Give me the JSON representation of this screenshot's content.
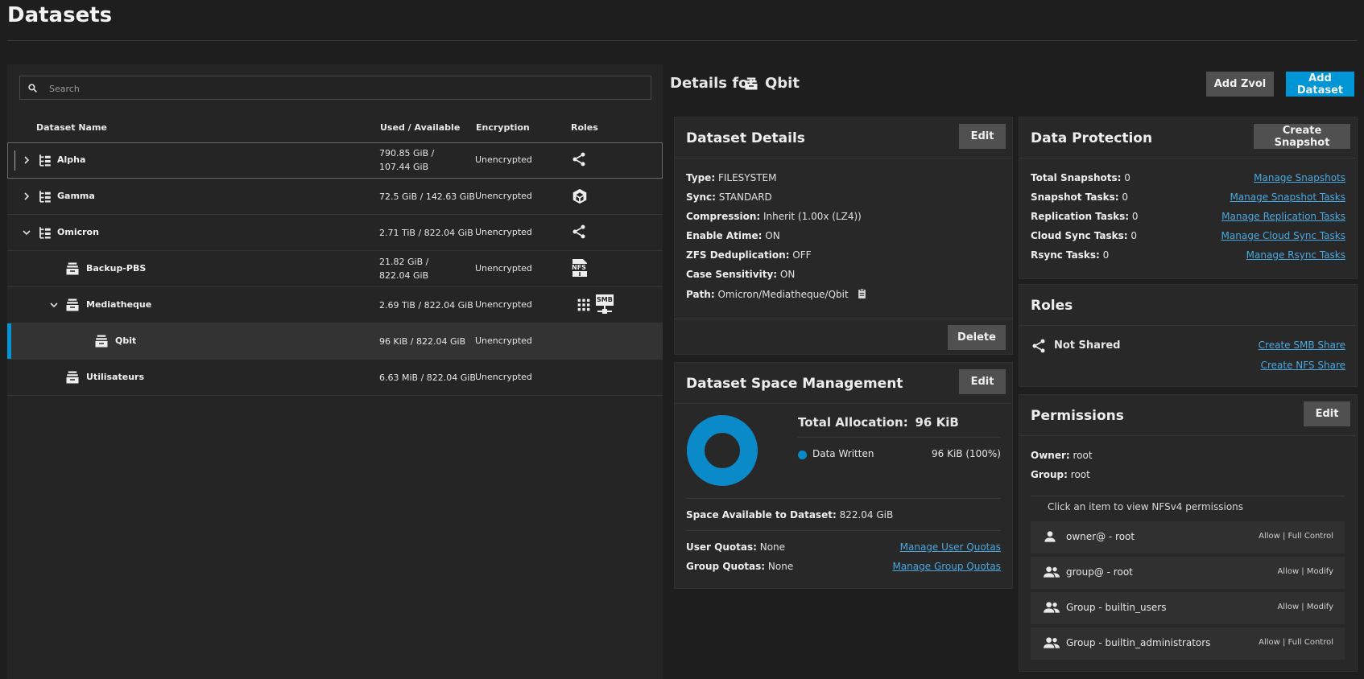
{
  "page_title": "Datasets",
  "search": {
    "placeholder": "Search"
  },
  "table": {
    "headers": {
      "name": "Dataset Name",
      "used": "Used / Available",
      "encryption": "Encryption",
      "roles": "Roles"
    },
    "rows": [
      {
        "name": "Alpha",
        "used_line1": "790.85 GiB /",
        "used_line2": "107.44 GiB",
        "encryption": "Unencrypted",
        "icon": "pool-tree-icon",
        "caret": "chevron-right-icon",
        "roles": [
          "share-icon"
        ]
      },
      {
        "name": "Gamma",
        "used_line1": "72.5 GiB / 142.63 GiB",
        "used_line2": "",
        "encryption": "Unencrypted",
        "icon": "pool-tree-icon",
        "caret": "chevron-right-icon",
        "roles": [
          "apps-cube-icon"
        ]
      },
      {
        "name": "Omicron",
        "used_line1": "2.71 TiB / 822.04 GiB",
        "used_line2": "",
        "encryption": "Unencrypted",
        "icon": "pool-tree-icon",
        "caret": "chevron-down-icon",
        "roles": [
          "share-icon"
        ]
      },
      {
        "name": "Backup-PBS",
        "used_line1": "21.82 GiB /",
        "used_line2": "822.04 GiB",
        "encryption": "Unencrypted",
        "icon": "dataset-icon",
        "caret": "",
        "roles": [
          "nfs-share-icon"
        ],
        "role_label": "NFS"
      },
      {
        "name": "Mediatheque",
        "used_line1": "2.69 TiB / 822.04 GiB",
        "used_line2": "",
        "encryption": "Unencrypted",
        "icon": "dataset-icon",
        "caret": "chevron-down-icon",
        "roles": [
          "apps-grid-icon",
          "smb-share-icon"
        ],
        "role_label": "SMB"
      },
      {
        "name": "Qbit",
        "used_line1": "96 KiB / 822.04 GiB",
        "used_line2": "",
        "encryption": "Unencrypted",
        "icon": "dataset-icon",
        "caret": "",
        "roles": []
      },
      {
        "name": "Utilisateurs",
        "used_line1": "6.63 MiB / 822.04 GiB",
        "used_line2": "",
        "encryption": "Unencrypted",
        "icon": "dataset-icon",
        "caret": "",
        "roles": []
      }
    ]
  },
  "details_header": {
    "prefix": "Details for",
    "name": "Qbit"
  },
  "buttons": {
    "add_zvol": "Add Zvol",
    "add_dataset": "Add Dataset"
  },
  "dataset_details": {
    "title": "Dataset Details",
    "edit": "Edit",
    "delete": "Delete",
    "fields": [
      {
        "label": "Type:",
        "value": "FILESYSTEM"
      },
      {
        "label": "Sync:",
        "value": "STANDARD"
      },
      {
        "label": "Compression:",
        "value": "Inherit (1.00x (LZ4))"
      },
      {
        "label": "Enable Atime:",
        "value": "ON"
      },
      {
        "label": "ZFS Deduplication:",
        "value": "OFF"
      },
      {
        "label": "Case Sensitivity:",
        "value": "ON"
      },
      {
        "label": "Path:",
        "value": "Omicron/Mediatheque/Qbit"
      }
    ]
  },
  "space": {
    "title": "Dataset Space Management",
    "edit": "Edit",
    "total_label": "Total Allocation:",
    "total_value": "96 KiB",
    "legend_label": "Data Written",
    "legend_value": "96 KiB (100%)",
    "written_fraction": 1.0,
    "available_label": "Space Available to Dataset:",
    "available_value": "822.04 GiB",
    "user_quotas_label": "User Quotas:",
    "user_quotas_value": "None",
    "group_quotas_label": "Group Quotas:",
    "group_quotas_value": "None",
    "manage_user_quotas": "Manage User Quotas",
    "manage_group_quotas": "Manage Group Quotas",
    "color": "#0a8ac8"
  },
  "protection": {
    "title": "Data Protection",
    "create_snapshot": "Create Snapshot",
    "items": [
      {
        "label": "Total Snapshots:",
        "value": "0",
        "link": "Manage Snapshots"
      },
      {
        "label": "Snapshot Tasks:",
        "value": "0",
        "link": "Manage Snapshot Tasks"
      },
      {
        "label": "Replication Tasks:",
        "value": "0",
        "link": "Manage Replication Tasks"
      },
      {
        "label": "Cloud Sync Tasks:",
        "value": "0",
        "link": "Manage Cloud Sync Tasks"
      },
      {
        "label": "Rsync Tasks:",
        "value": "0",
        "link": "Manage Rsync Tasks"
      }
    ]
  },
  "roles": {
    "title": "Roles",
    "status": "Not Shared",
    "create_smb": "Create SMB Share",
    "create_nfs": "Create NFS Share"
  },
  "permissions": {
    "title": "Permissions",
    "edit": "Edit",
    "owner_label": "Owner:",
    "owner_value": "root",
    "group_label": "Group:",
    "group_value": "root",
    "hint": "Click an item to view NFSv4 permissions",
    "items": [
      {
        "name": "owner@ - root",
        "value": "Allow | Full Control",
        "icon": "user-icon"
      },
      {
        "name": "group@ - root",
        "value": "Allow | Modify",
        "icon": "group-icon"
      },
      {
        "name": "Group - builtin_users",
        "value": "Allow | Modify",
        "icon": "group-icon"
      },
      {
        "name": "Group - builtin_administrators",
        "value": "Allow | Full Control",
        "icon": "group-icon"
      }
    ]
  },
  "colors": {
    "accent": "#0095d5",
    "link": "#4aa8e0",
    "panel": "#252525",
    "background": "#1e1e1e"
  }
}
